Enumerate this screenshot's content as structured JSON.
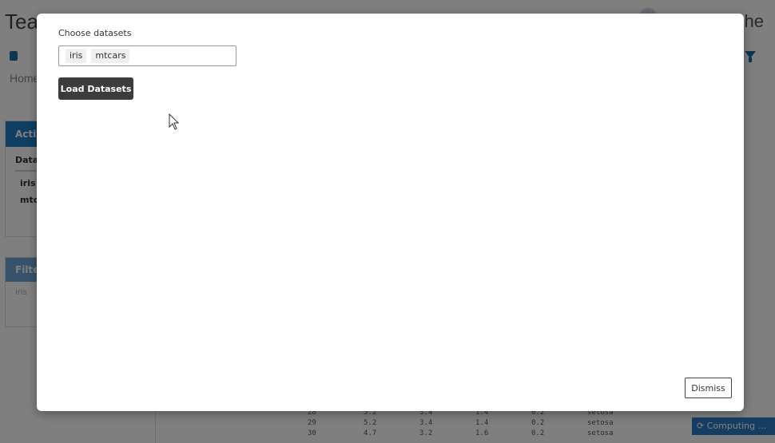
{
  "app": {
    "title": "Tea",
    "title_right": "he",
    "breadcrumb": "Home",
    "active_panel": {
      "header": "Activ",
      "column": "Data",
      "rows": [
        "iris",
        "mtc"
      ]
    },
    "filter_panel": {
      "header": "Filte",
      "text": "iris"
    },
    "table_rows": [
      [
        "28",
        "5.2",
        "3.4",
        "1.4",
        "0.2",
        "setosa"
      ],
      [
        "29",
        "5.2",
        "3.4",
        "1.4",
        "0.2",
        "setosa"
      ],
      [
        "30",
        "4.7",
        "3.2",
        "1.6",
        "0.2",
        "setosa"
      ]
    ],
    "computing_label": "Computing ...",
    "colors": {
      "primary": "#1c7dc2",
      "dark_button": "#3c3c3c"
    }
  },
  "modal": {
    "choose_label": "Choose datasets",
    "selected_datasets": [
      "iris",
      "mtcars"
    ],
    "load_button_label": "Load Datasets",
    "dismiss_button_label": "Dismiss"
  },
  "icons": {
    "database": "database-icon",
    "filter": "filter-icon",
    "cursor": "mouse-pointer-icon",
    "refresh": "refresh-icon"
  }
}
